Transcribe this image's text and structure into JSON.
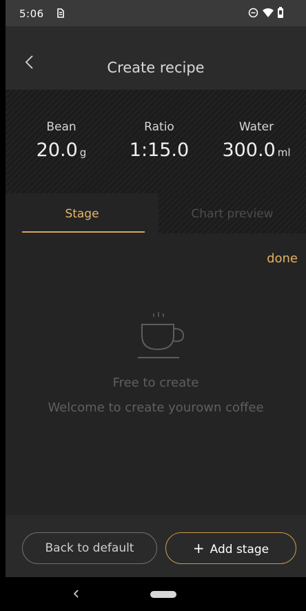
{
  "status_bar": {
    "time": "5:06"
  },
  "header": {
    "title": "Create recipe"
  },
  "stats": {
    "bean": {
      "label": "Bean",
      "value": "20.0",
      "unit": "g"
    },
    "ratio": {
      "label": "Ratio",
      "value": "1:15.0"
    },
    "water": {
      "label": "Water",
      "value": "300.0",
      "unit": "ml"
    }
  },
  "tabs": [
    {
      "label": "Stage",
      "active": true
    },
    {
      "label": "Chart preview",
      "active": false
    }
  ],
  "content": {
    "done_label": "done",
    "empty_title": "Free to create",
    "empty_subtitle": "Welcome to create yourown coffee"
  },
  "actions": {
    "back_default_label": "Back to default",
    "add_stage_label": "Add stage"
  },
  "colors": {
    "accent": "#e4b35f",
    "background": "#242424",
    "header": "#2b2b2b"
  },
  "icons": [
    "back-chevron-icon",
    "sim-icon",
    "dnd-icon",
    "wifi-icon",
    "battery-icon",
    "coffee-cup-icon"
  ]
}
